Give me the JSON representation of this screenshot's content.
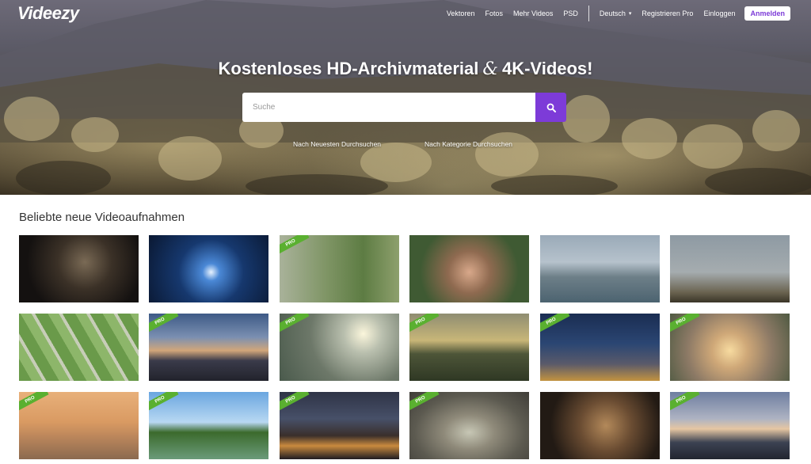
{
  "header": {
    "logo": "Videezy",
    "nav": [
      "Vektoren",
      "Fotos",
      "Mehr Videos",
      "PSD"
    ],
    "language": "Deutsch",
    "register": "Registrieren Pro",
    "signin": "Einloggen",
    "login_button": "Anmelden"
  },
  "hero": {
    "title_part1": "Kostenloses HD-Archivmaterial",
    "title_amp": "&",
    "title_part2": "4K-Videos!",
    "search_placeholder": "Suche",
    "link_newest": "Nach Neuesten Durchsuchen",
    "link_category": "Nach Kategorie Durchsuchen"
  },
  "section": {
    "title": "Beliebte neue Videoaufnahmen"
  },
  "pro_label": "PRO",
  "colors": {
    "accent": "#7d3bd8",
    "pro_badge": "#5ab030"
  },
  "videos": [
    {
      "subject": "vinyl record player",
      "pro": false
    },
    {
      "subject": "hands holding glowing tablet",
      "pro": false
    },
    {
      "subject": "elderly man in garden",
      "pro": true
    },
    {
      "subject": "girl with headphones",
      "pro": false
    },
    {
      "subject": "harbor with boats",
      "pro": false
    },
    {
      "subject": "man with model airplane",
      "pro": false
    },
    {
      "subject": "aerial rice fields",
      "pro": false
    },
    {
      "subject": "city skyline at dusk",
      "pro": true
    },
    {
      "subject": "cloudy sky over water",
      "pro": true
    },
    {
      "subject": "sunset over river and hills",
      "pro": true
    },
    {
      "subject": "boat on river night sky",
      "pro": true
    },
    {
      "subject": "sunrise over misty forest",
      "pro": true
    },
    {
      "subject": "wooden pier at sunset",
      "pro": true
    },
    {
      "subject": "tree island on lake",
      "pro": true
    },
    {
      "subject": "city skyline at night",
      "pro": true
    },
    {
      "subject": "roundabout aerial view",
      "pro": true
    },
    {
      "subject": "hand playing guitar",
      "pro": false
    },
    {
      "subject": "mountain landscape at dusk",
      "pro": true
    }
  ]
}
